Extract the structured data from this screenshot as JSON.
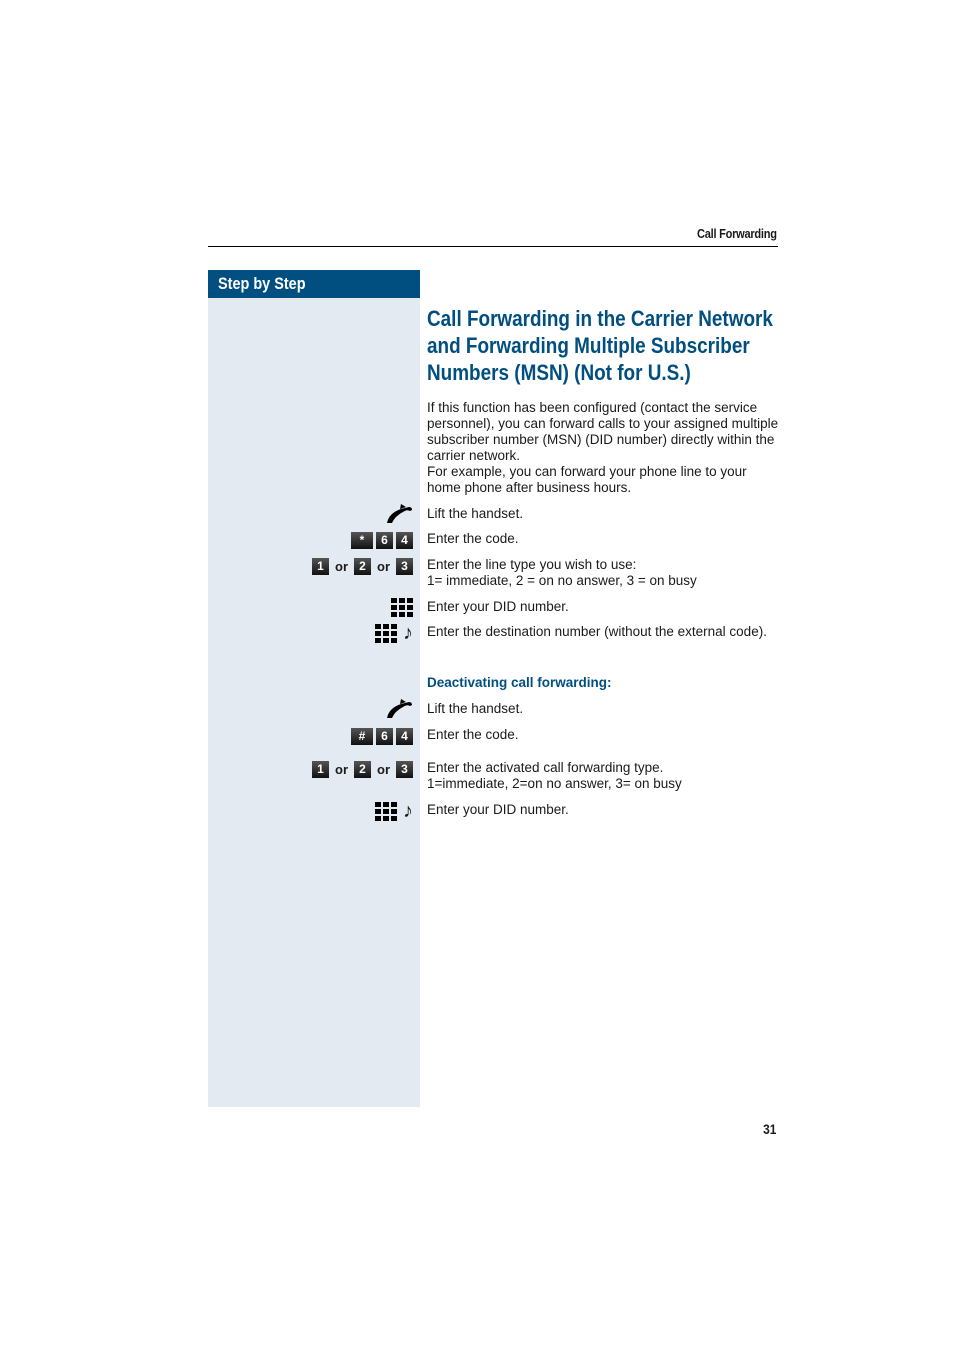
{
  "header": {
    "section_title": "Call Forwarding"
  },
  "sidebar": {
    "heading": "Step by Step"
  },
  "main": {
    "title": "Call Forwarding in the Carrier Network and Forwarding Multiple Subscriber Numbers (MSN) (Not for U.S.)",
    "intro_lines": [
      "If this function has been configured (contact the service personnel), you can forward calls to your assigned multiple subscriber number (MSN) (DID number) directly within the carrier network.",
      "For example, you can forward your phone line to your home phone after business hours."
    ],
    "steps": [
      {
        "icon": "handset-icon",
        "text": "Lift the handset."
      },
      {
        "icon": "code-keys",
        "keys": [
          "*",
          "6",
          "4"
        ],
        "text": "Enter the code."
      },
      {
        "icon": "choice-keys",
        "keys": [
          "1",
          "2",
          "3"
        ],
        "or_label": "or",
        "text": "Enter the line type you wish to use:",
        "text2": "1= immediate, 2 = on no answer, 3 =  on busy"
      },
      {
        "icon": "keypad-icon",
        "text": "Enter your DID number."
      },
      {
        "icon": "keypad-tone-icon",
        "text": "Enter the destination number (without the external code)."
      }
    ],
    "deactivate_heading": "Deactivating call forwarding:",
    "deactivate_steps": [
      {
        "icon": "handset-icon",
        "text": "Lift the handset."
      },
      {
        "icon": "code-keys",
        "keys": [
          "#",
          "6",
          "4"
        ],
        "text": "Enter the code."
      },
      {
        "icon": "choice-keys",
        "keys": [
          "1",
          "2",
          "3"
        ],
        "or_label": "or",
        "text": "Enter the activated call forwarding type.",
        "text2": "1=immediate, 2=on no answer, 3= on busy"
      },
      {
        "icon": "keypad-tone-icon",
        "text": "Enter your DID number."
      }
    ]
  },
  "footer": {
    "page_number": "31"
  }
}
